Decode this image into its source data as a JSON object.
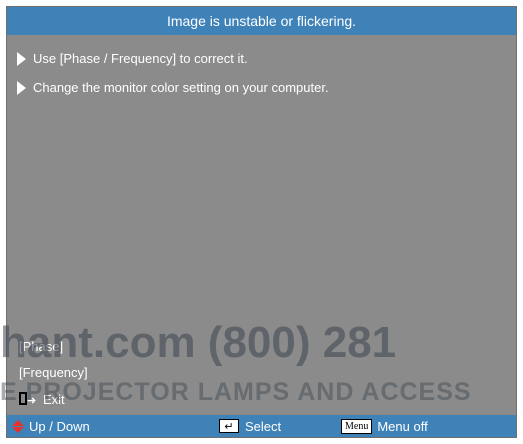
{
  "osd": {
    "title": "Image is unstable or flickering.",
    "tips": [
      "Use [Phase / Frequency] to correct it.",
      "Change the monitor color setting on your computer."
    ],
    "options": {
      "phase": "[Phase]",
      "frequency": "[Frequency]",
      "exit": "Exit"
    },
    "bottom_bar": {
      "up_down": "Up / Down",
      "enter_key_icon": "↵",
      "select": "Select",
      "menu_key": "Menu",
      "menu_off": "Menu off"
    }
  },
  "watermark": {
    "line1": "hant.com (800) 281",
    "line2": "E PROJECTOR LAMPS AND ACCESS"
  },
  "icons": {
    "tip_bullet": "triangle-right-icon",
    "exit": "exit-icon",
    "up_down": "up-down-arrow-icon",
    "enter": "enter-key-icon",
    "menu": "menu-key-icon"
  },
  "colors": {
    "panel_bg": "#8b8b8b",
    "bar_bg": "#3f82b8",
    "arrow_red": "#e4332a",
    "text": "#ffffff"
  }
}
